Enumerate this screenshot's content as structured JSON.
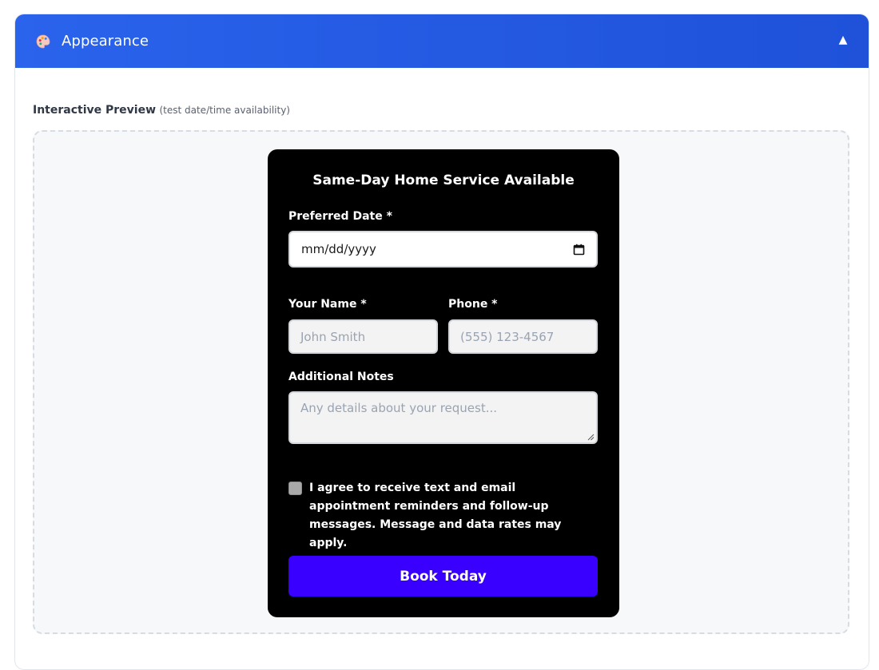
{
  "panel": {
    "title": "Appearance",
    "icon": "palette-icon",
    "collapse_icon": "caret-up-icon",
    "collapse_glyph": "▲",
    "header_color": "#2563eb"
  },
  "preview": {
    "label": "Interactive Preview",
    "hint": "(test date/time availability)"
  },
  "form": {
    "title": "Same-Day Home Service Available",
    "date": {
      "label": "Preferred Date *",
      "value": "mm/dd/yyyy",
      "icon": "calendar-icon"
    },
    "name": {
      "label": "Your Name *",
      "placeholder": "John Smith"
    },
    "phone": {
      "label": "Phone *",
      "placeholder": "(555) 123-4567"
    },
    "notes": {
      "label": "Additional Notes",
      "placeholder": "Any details about your request..."
    },
    "consent": {
      "checked": false,
      "text": "I agree to receive text and email appointment reminders and follow-up messages. Message and data rates may apply."
    },
    "submit_label": "Book Today",
    "colors": {
      "card_background": "#000000",
      "button_background": "#3a00ff",
      "text": "#ffffff"
    }
  }
}
